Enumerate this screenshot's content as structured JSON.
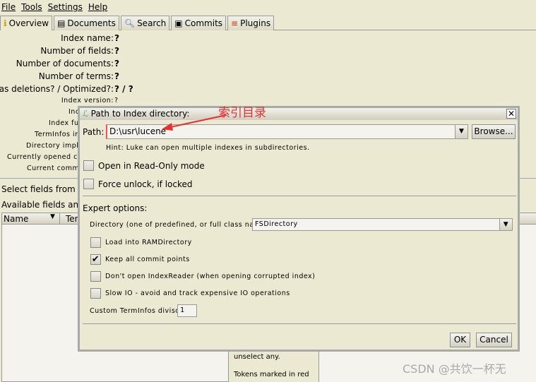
{
  "menu": [
    "File",
    "Tools",
    "Settings",
    "Help"
  ],
  "tabs": [
    {
      "label": "Overview",
      "icon": "overview-icon"
    },
    {
      "label": "Documents",
      "icon": "documents-icon"
    },
    {
      "label": "Search",
      "icon": "search-icon"
    },
    {
      "label": "Commits",
      "icon": "commits-icon"
    },
    {
      "label": "Plugins",
      "icon": "plugins-icon"
    }
  ],
  "overview": {
    "index_name": "Index name:",
    "number_of_fields": "Number of fields:",
    "number_of_documents": "Number of documents:",
    "number_of_terms": "Number of terms:",
    "has_deletions": "Has deletions? / Optimized?:",
    "q": "?",
    "q2": "? / ?",
    "index_version": "Index version:",
    "index_prefix": "Inc",
    "index_func": "Index fun",
    "terminfos": "TermInfos inc",
    "dir_impl": "Directory imple",
    "current_opened": "Currently opened co",
    "current_commit": "Current commi",
    "select_fields": "Select fields from th",
    "available_fields": "Available fields and",
    "col_name": "Name",
    "col_term": "Ter",
    "panel_text1": "unselect any.",
    "panel_text2": "Tokens marked in red"
  },
  "dialog": {
    "title": "Path to Index directory:",
    "path_label": "Path:",
    "path_value": "D:\\usr\\lucene",
    "browse": "Browse...",
    "hint": "Hint: Luke can open multiple indexes in subdirectories.",
    "readonly": {
      "label": "Open in Read-Only mode",
      "checked": false
    },
    "force_unlock": {
      "label": "Force unlock, if locked",
      "checked": false
    },
    "expert": "Expert options:",
    "directory_label": "Directory (one of predefined, or full class name):",
    "directory_value": "FSDirectory",
    "load_ram": {
      "label": "Load into RAMDirectory",
      "checked": false
    },
    "keep_commits": {
      "label": "Keep all commit points",
      "checked": true
    },
    "dont_open": {
      "label": "Don't open IndexReader (when opening corrupted index)",
      "checked": false
    },
    "slow_io": {
      "label": "Slow IO - avoid and track expensive IO operations",
      "checked": false
    },
    "divisor_label": "Custom TermInfos divisor:",
    "divisor_value": "1",
    "ok": "OK",
    "cancel": "Cancel"
  },
  "annotation": "索引目录",
  "watermark": "CSDN @共饮一杯无"
}
